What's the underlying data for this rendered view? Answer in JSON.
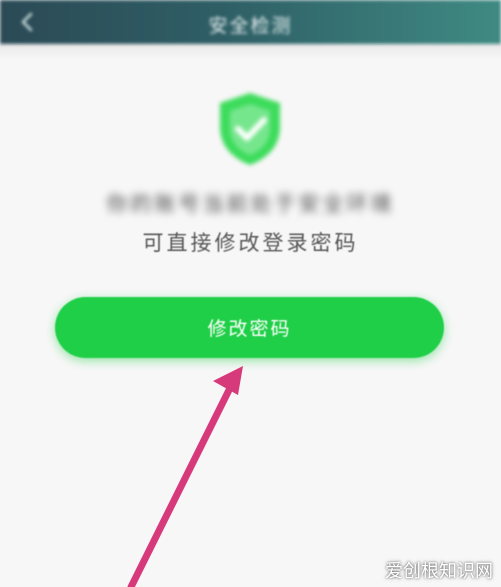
{
  "header": {
    "title": "安全检测",
    "back_icon": "back-arrow-icon",
    "colors": {
      "start": "#2b4a56",
      "end": "#3f8a83"
    }
  },
  "status": {
    "icon": "shield-check-icon",
    "icon_color": "#3ddc5c",
    "line1": "你的账号当前处于安全环境",
    "line2": "可直接修改登录密码"
  },
  "action": {
    "change_password_label": "修改密码",
    "color": "#1fcf47"
  },
  "annotation": {
    "arrow_icon": "pointer-arrow-icon",
    "arrow_color": "#d63a7b"
  },
  "watermark": {
    "text": "爱创根知识网"
  }
}
